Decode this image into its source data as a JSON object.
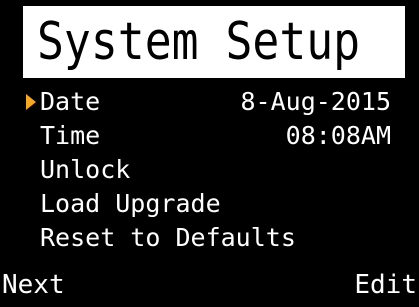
{
  "header": {
    "title": "System Setup"
  },
  "menu": {
    "selected_index": 0,
    "cursor_icon": "triangle-right-icon",
    "cursor_color": "#f5a623",
    "items": [
      {
        "label": "Date",
        "value": "8-Aug-2015"
      },
      {
        "label": "Time",
        "value": "08:08AM"
      },
      {
        "label": "Unlock",
        "value": ""
      },
      {
        "label": "Load Upgrade",
        "value": ""
      },
      {
        "label": "Reset to Defaults",
        "value": ""
      }
    ]
  },
  "softkeys": {
    "left_label": "Next",
    "right_label": "Edit"
  },
  "colors": {
    "background": "#000000",
    "foreground": "#ffffff",
    "title_bar": "#ffffff",
    "title_text": "#000000"
  }
}
